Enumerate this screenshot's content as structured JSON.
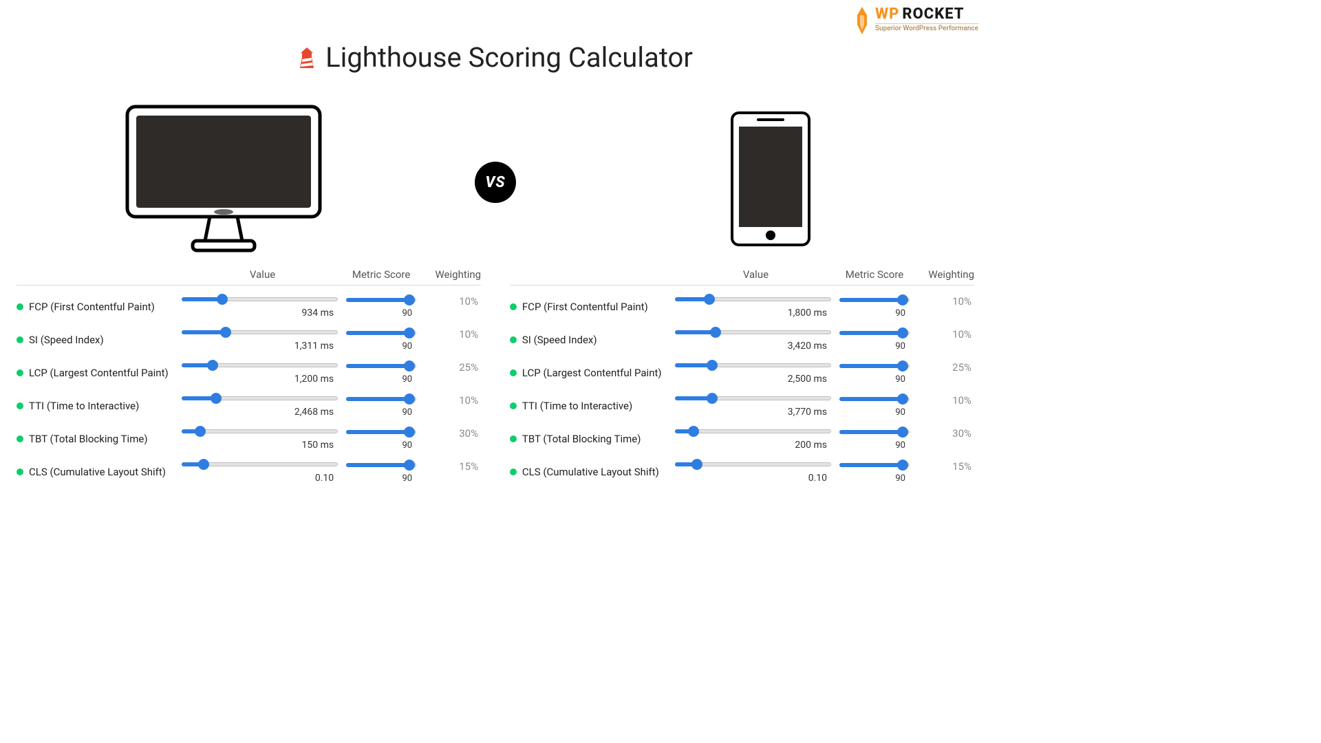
{
  "logo": {
    "word1": "WP",
    "word2": "ROCKET",
    "tagline": "Superior WordPress Performance"
  },
  "title": "Lighthouse Scoring Calculator",
  "vs_label": "VS",
  "columns": {
    "value": "Value",
    "metric_score": "Metric Score",
    "weighting": "Weighting"
  },
  "desktop": {
    "metrics": [
      {
        "label": "FCP (First Contentful Paint)",
        "value_text": "934 ms",
        "value_pct": 26,
        "score_text": "90",
        "score_pct": 90,
        "weight": "10%"
      },
      {
        "label": "SI (Speed Index)",
        "value_text": "1,311 ms",
        "value_pct": 28,
        "score_text": "90",
        "score_pct": 90,
        "weight": "10%"
      },
      {
        "label": "LCP (Largest Contentful Paint)",
        "value_text": "1,200 ms",
        "value_pct": 20,
        "score_text": "90",
        "score_pct": 90,
        "weight": "25%"
      },
      {
        "label": "TTI (Time to Interactive)",
        "value_text": "2,468 ms",
        "value_pct": 22,
        "score_text": "90",
        "score_pct": 90,
        "weight": "10%"
      },
      {
        "label": "TBT (Total Blocking Time)",
        "value_text": "150 ms",
        "value_pct": 12,
        "score_text": "90",
        "score_pct": 90,
        "weight": "30%"
      },
      {
        "label": "CLS (Cumulative Layout Shift)",
        "value_text": "0.10",
        "value_pct": 14,
        "score_text": "90",
        "score_pct": 90,
        "weight": "15%"
      }
    ]
  },
  "mobile": {
    "metrics": [
      {
        "label": "FCP (First Contentful Paint)",
        "value_text": "1,800 ms",
        "value_pct": 22,
        "score_text": "90",
        "score_pct": 90,
        "weight": "10%"
      },
      {
        "label": "SI (Speed Index)",
        "value_text": "3,420 ms",
        "value_pct": 26,
        "score_text": "90",
        "score_pct": 90,
        "weight": "10%"
      },
      {
        "label": "LCP (Largest Contentful Paint)",
        "value_text": "2,500 ms",
        "value_pct": 24,
        "score_text": "90",
        "score_pct": 90,
        "weight": "25%"
      },
      {
        "label": "TTI (Time to Interactive)",
        "value_text": "3,770 ms",
        "value_pct": 24,
        "score_text": "90",
        "score_pct": 90,
        "weight": "10%"
      },
      {
        "label": "TBT (Total Blocking Time)",
        "value_text": "200 ms",
        "value_pct": 12,
        "score_text": "90",
        "score_pct": 90,
        "weight": "30%"
      },
      {
        "label": "CLS (Cumulative Layout Shift)",
        "value_text": "0.10",
        "value_pct": 14,
        "score_text": "90",
        "score_pct": 90,
        "weight": "15%"
      }
    ]
  }
}
